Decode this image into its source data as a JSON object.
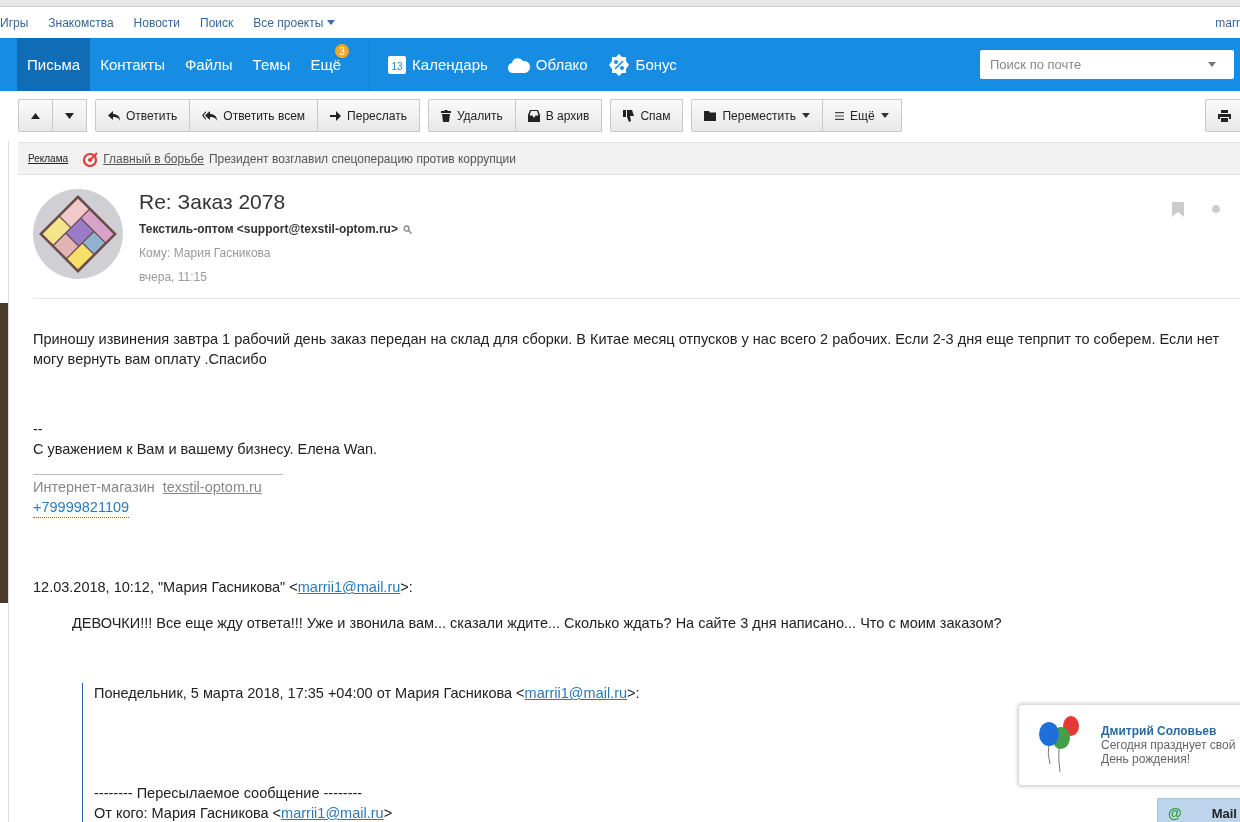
{
  "top_links": [
    {
      "label": "Игры",
      "caret": false
    },
    {
      "label": "Знакомства",
      "caret": false
    },
    {
      "label": "Новости",
      "caret": false
    },
    {
      "label": "Поиск",
      "caret": false
    },
    {
      "label": "Все проекты",
      "caret": true
    }
  ],
  "user": "marr",
  "nav": {
    "tabs": [
      {
        "label": "Письма",
        "selected": true
      },
      {
        "label": "Контакты",
        "selected": false
      },
      {
        "label": "Файлы",
        "selected": false
      },
      {
        "label": "Темы",
        "selected": false
      },
      {
        "label": "Ещё",
        "selected": false,
        "badge": "3"
      }
    ],
    "services": [
      {
        "kind": "calendar",
        "label": "Календарь",
        "day": "13"
      },
      {
        "kind": "cloud",
        "label": "Облако"
      },
      {
        "kind": "bonus",
        "label": "Бонус"
      }
    ],
    "search": {
      "placeholder": "Поиск по почте"
    }
  },
  "toolbar": {
    "groups": [
      [
        {
          "kind": "up"
        },
        {
          "kind": "down"
        }
      ],
      [
        {
          "kind": "reply",
          "label": "Ответить"
        },
        {
          "kind": "reply-all",
          "label": "Ответить всем"
        },
        {
          "kind": "forward",
          "label": "Переслать"
        }
      ],
      [
        {
          "kind": "delete",
          "label": "Удалить"
        },
        {
          "kind": "archive",
          "label": "В архив"
        }
      ],
      [
        {
          "kind": "spam",
          "label": "Спам"
        }
      ],
      [
        {
          "kind": "move",
          "label": "Переместить",
          "caret": true
        },
        {
          "kind": "more",
          "label": "Ещё",
          "caret": true
        }
      ]
    ],
    "right": [
      {
        "kind": "print"
      }
    ]
  },
  "ad": {
    "label": "Реклама",
    "link": "Главный в борьбе",
    "text": "Президент возглавил спецоперацию против коррупции"
  },
  "message": {
    "subject": "Re: Заказ 2078",
    "from": "Текстиль-оптом <support@texstil-optom.ru>",
    "to": "Кому: Мария Гасникова",
    "date": "вчера, 11:15"
  },
  "body": {
    "text": "Приношу извинения завтра 1 рабочий день заказ передан на склад для сборки. В Китае месяц отпусков у нас всего 2 рабочих. Если 2-3 дня еще тепрпит то соберем. Если нет могу вернуть вам оплату .Спасибо",
    "sig_dash": "--",
    "sig": "С уважением к Вам и вашему бизнесу. Елена Wan.",
    "shop_label": "Интернет-магазин",
    "shop_link": "texstil-optom.ru",
    "phone": "+79999821109"
  },
  "quote": {
    "header": {
      "prefix": "12.03.2018, 10:12, \"Мария Гасникова\" <",
      "email": "marrii1@mail.ru",
      "suffix": ">:"
    },
    "text": "ДЕВОЧКИ!!! Все еще жду ответа!!! Уже и звонила вам... сказали ждите... Сколько ждать? На сайте 3 дня написано... Что с моим заказом?",
    "inner": {
      "header": {
        "prefix": "Понедельник, 5 марта 2018, 17:35 +04:00 от Мария Гасникова <",
        "email": "marrii1@mail.ru",
        "suffix": ">:"
      },
      "forward_title": "-------- Пересылаемое сообщение --------",
      "from": {
        "prefix": "От кого: Мария Гасникова <",
        "email": "marrii1@mail.ru",
        "suffix": ">"
      }
    }
  },
  "notification": {
    "name": "Дмитрий Соловьев",
    "text": "Сегодня празднует свой День рождения!"
  },
  "agent_tab": {
    "icon": "@",
    "label": "Mail"
  }
}
